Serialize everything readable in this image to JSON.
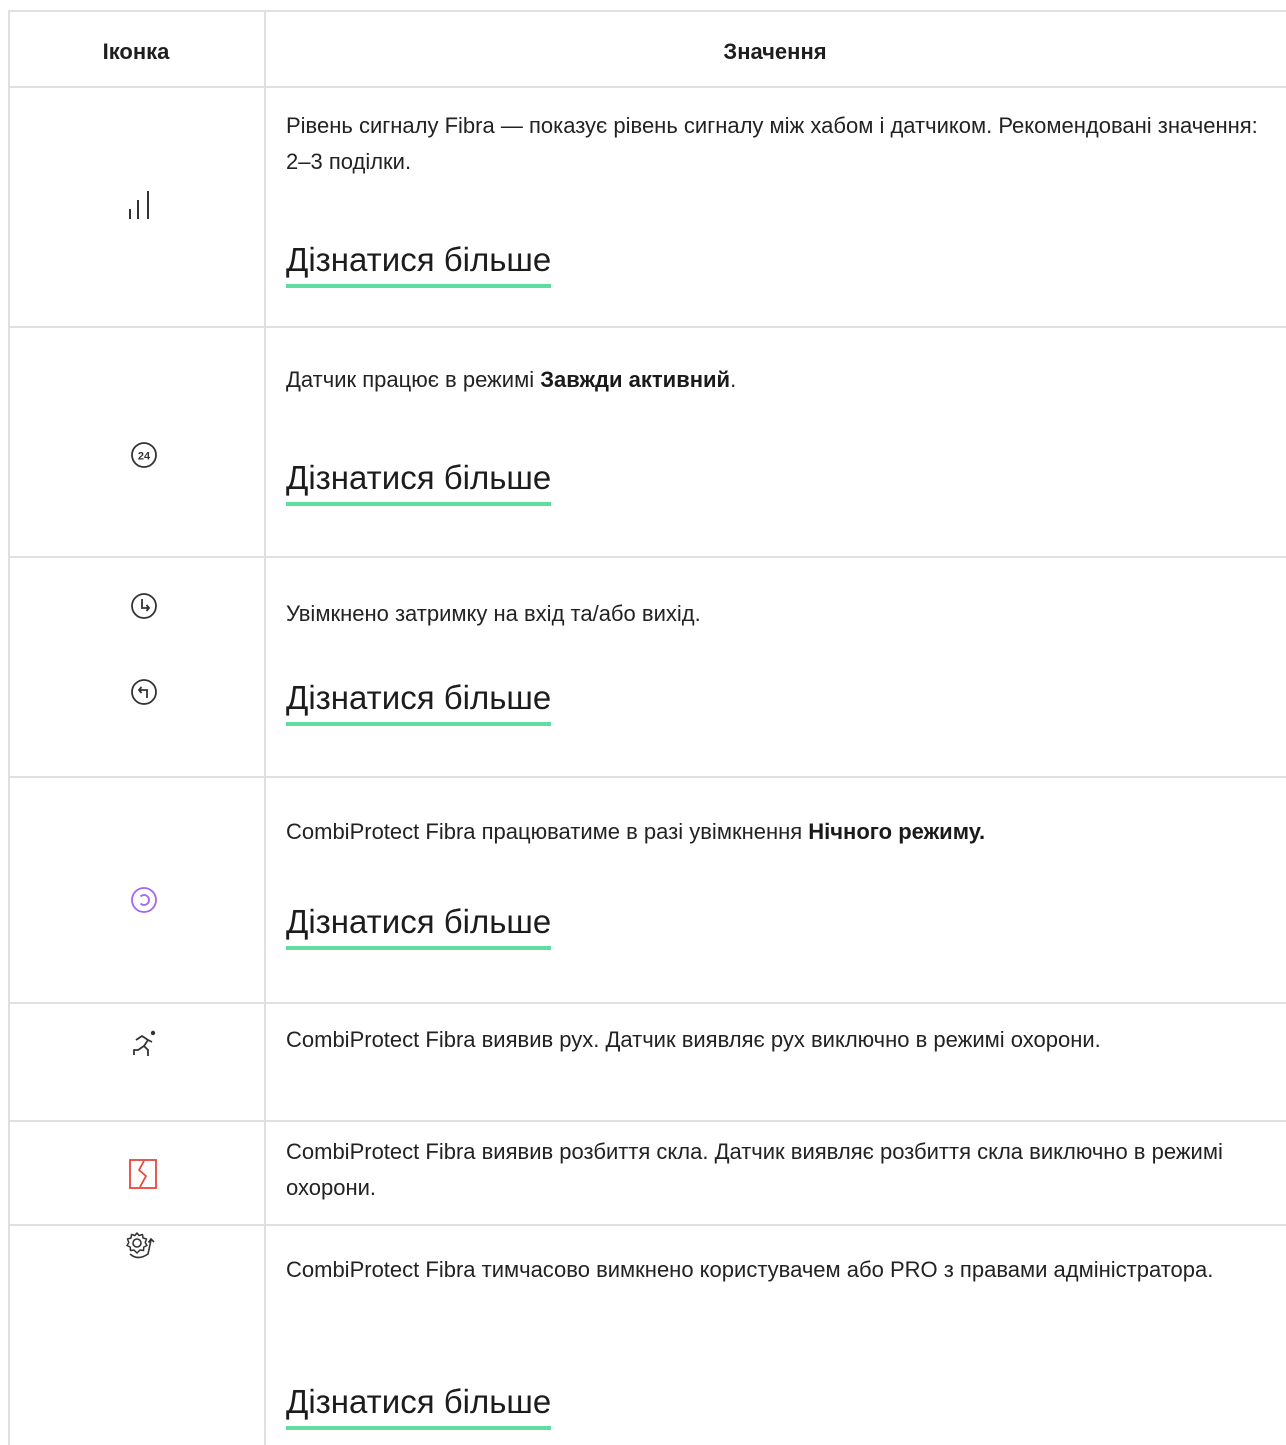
{
  "table": {
    "headers": {
      "icon": "Іконка",
      "value": "Значення"
    },
    "link_label": "Дізнатися більше",
    "rows": [
      {
        "icon": "signal-strength-icon",
        "text": "Рівень сигналу Fibra — показує рівень сигналу між хабом і датчиком. Рекомендовані значення: 2–3 поділки."
      },
      {
        "icon": "always-active-24-icon",
        "text_before": "Датчик працює в режимі ",
        "text_bold": "Завжди активний",
        "text_after": "."
      },
      {
        "icon": "entry-exit-delay-icons",
        "text": "Увімкнено затримку на вхід та/або вихід."
      },
      {
        "icon": "night-mode-icon",
        "text_before": "CombiProtect Fibra працюватиме в разі увімкнення ",
        "text_bold": "Нічного режиму.",
        "text_after": ""
      },
      {
        "icon": "motion-detected-icon",
        "text": "CombiProtect Fibra виявив рух. Датчик виявляє рух виключно в режимі охорони."
      },
      {
        "icon": "glass-break-icon",
        "text": "CombiProtect Fibra виявив розбиття скла. Датчик виявляє розбиття скла виключно в режимі охорони."
      },
      {
        "icon": "temporarily-disabled-icon",
        "text": "CombiProtect Fibra тимчасово вимкнено користувачем або PRO з правами адміністратора."
      }
    ]
  },
  "colors": {
    "border": "#e0e0e0",
    "link_underline": "#5fdca0",
    "night_mode_icon": "#a466f0",
    "glass_break_icon": "#e8453c"
  }
}
